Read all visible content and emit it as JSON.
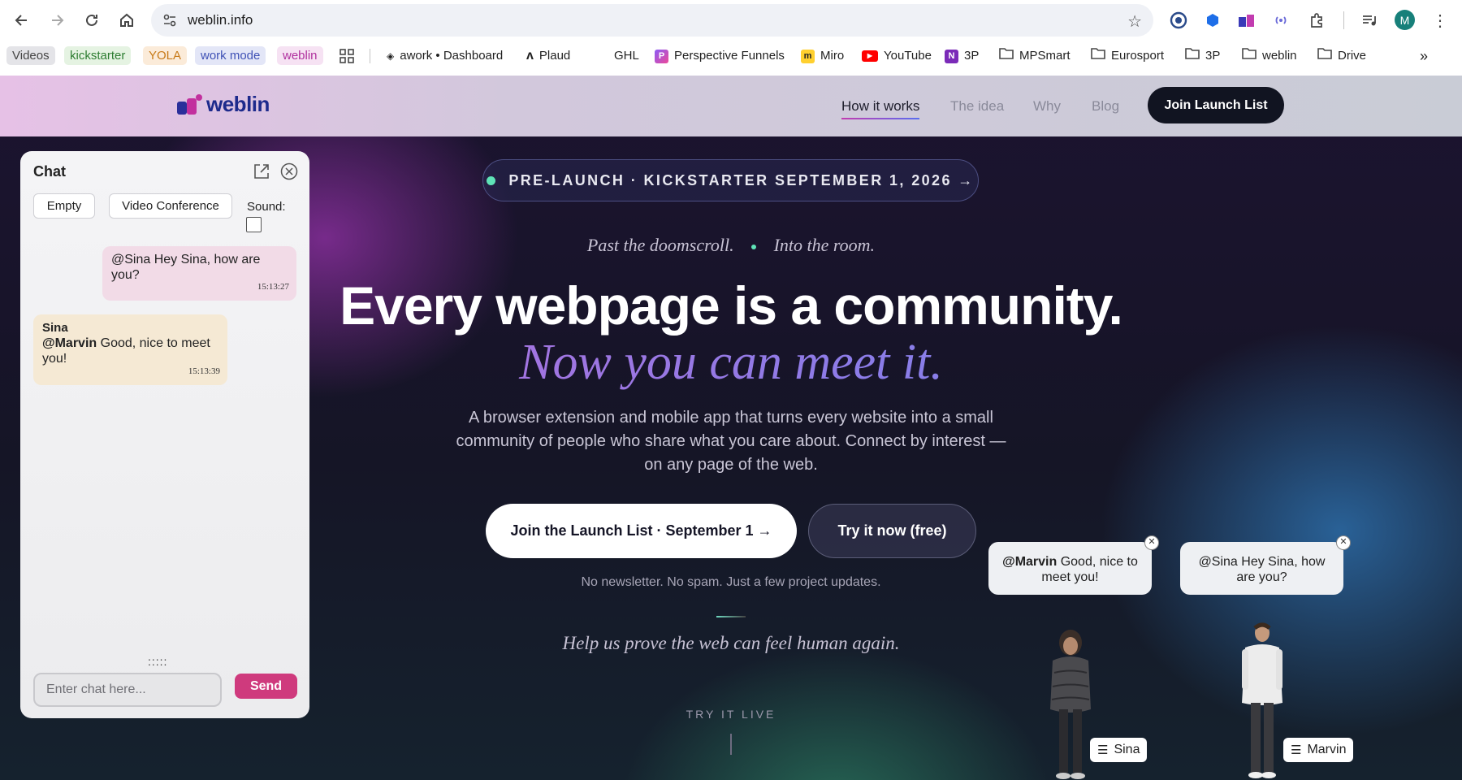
{
  "browser": {
    "url": "weblin.info",
    "profile_initial": "M",
    "bookmarks_chips": [
      "Videos",
      "kickstarter",
      "YOLA",
      "work mode",
      "weblin"
    ],
    "bookmarks": [
      "awork • Dashboard",
      "Plaud",
      "GHL",
      "Perspective Funnels",
      "Miro",
      "YouTube",
      "3P",
      "MPSmart",
      "Eurosport",
      "3P",
      "weblin",
      "Drive"
    ]
  },
  "site": {
    "logo": "weblin",
    "nav": [
      "How it works",
      "The idea",
      "Why",
      "Blog"
    ],
    "join_btn": "Join Launch List"
  },
  "hero": {
    "pill": "PRE-LAUNCH · KICKSTARTER SEPTEMBER 1, 2026 →",
    "tag_left": "Past the doomscroll.",
    "tag_right": "Into the room.",
    "headline": "Every webpage is a community.",
    "subheadline": "Now you can meet it.",
    "description": "A browser extension and mobile app that turns every website into a small community of people who share what you care about. Connect by interest — on any page of the web.",
    "cta_primary": "Join the Launch List · September 1 →",
    "cta_secondary": "Try it now (free)",
    "note": "No newsletter. No spam. Just a few project updates.",
    "tagline2": "Help us prove the web can feel human again.",
    "try_live": "TRY IT LIVE"
  },
  "chat": {
    "title": "Chat",
    "btn_empty": "Empty",
    "btn_video": "Video Conference",
    "sound_label": "Sound:",
    "msg1_text": "@Sina Hey Sina, how are you?",
    "msg1_time": "15:13:27",
    "msg2_sender": "Sina",
    "msg2_mention": "@Marvin",
    "msg2_text": " Good, nice to meet you!",
    "msg2_time": "15:13:39",
    "resize_handle": ":::::",
    "input_placeholder": "Enter chat here...",
    "send": "Send"
  },
  "avatars": {
    "sina_bubble_mention": "@Marvin",
    "sina_bubble_text": " Good, nice to meet you!",
    "marvin_bubble": "@Sina Hey Sina, how are you?",
    "sina_name": "Sina",
    "marvin_name": "Marvin"
  }
}
